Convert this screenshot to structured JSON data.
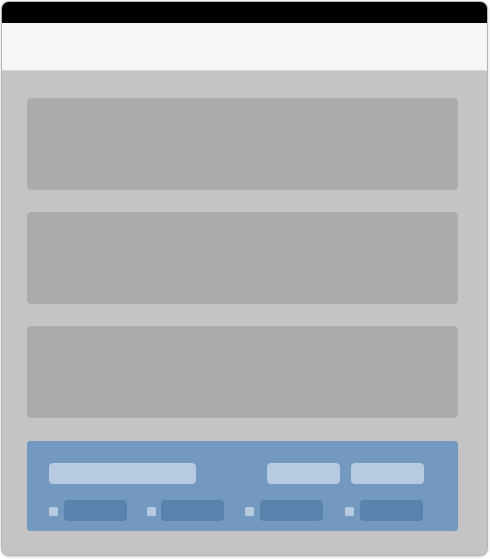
{
  "window": {
    "title": ""
  },
  "footer": {
    "options": [
      "",
      "",
      "",
      ""
    ]
  },
  "colors": {
    "titlebar": "#000000",
    "toolbar": "#f6f6f6",
    "window_bg": "#c4c4c4",
    "panel": "#ababab",
    "footer": "#7399c0",
    "footer_field": "#b6cbe0",
    "footer_button": "#5a82ad"
  }
}
